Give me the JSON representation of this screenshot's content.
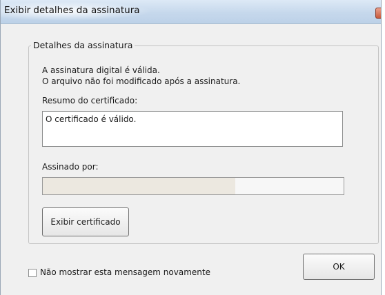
{
  "window": {
    "title": "Exibir detalhes da assinatura"
  },
  "group": {
    "legend": "Detalhes da assinatura",
    "status_line1": "A assinatura digital é válida.",
    "status_line2": "O arquivo não foi modificado após a assinatura.",
    "summary_label": "Resumo do certificado:",
    "summary_value": "O certificado é válido.",
    "signed_by_label": "Assinado por:",
    "signed_by_value": "",
    "view_certificate_button": "Exibir certificado"
  },
  "footer": {
    "dont_show_label": "Não mostrar esta mensagem novamente",
    "dont_show_checked": false,
    "ok_button": "OK"
  },
  "icons": {
    "close": "close-icon"
  }
}
